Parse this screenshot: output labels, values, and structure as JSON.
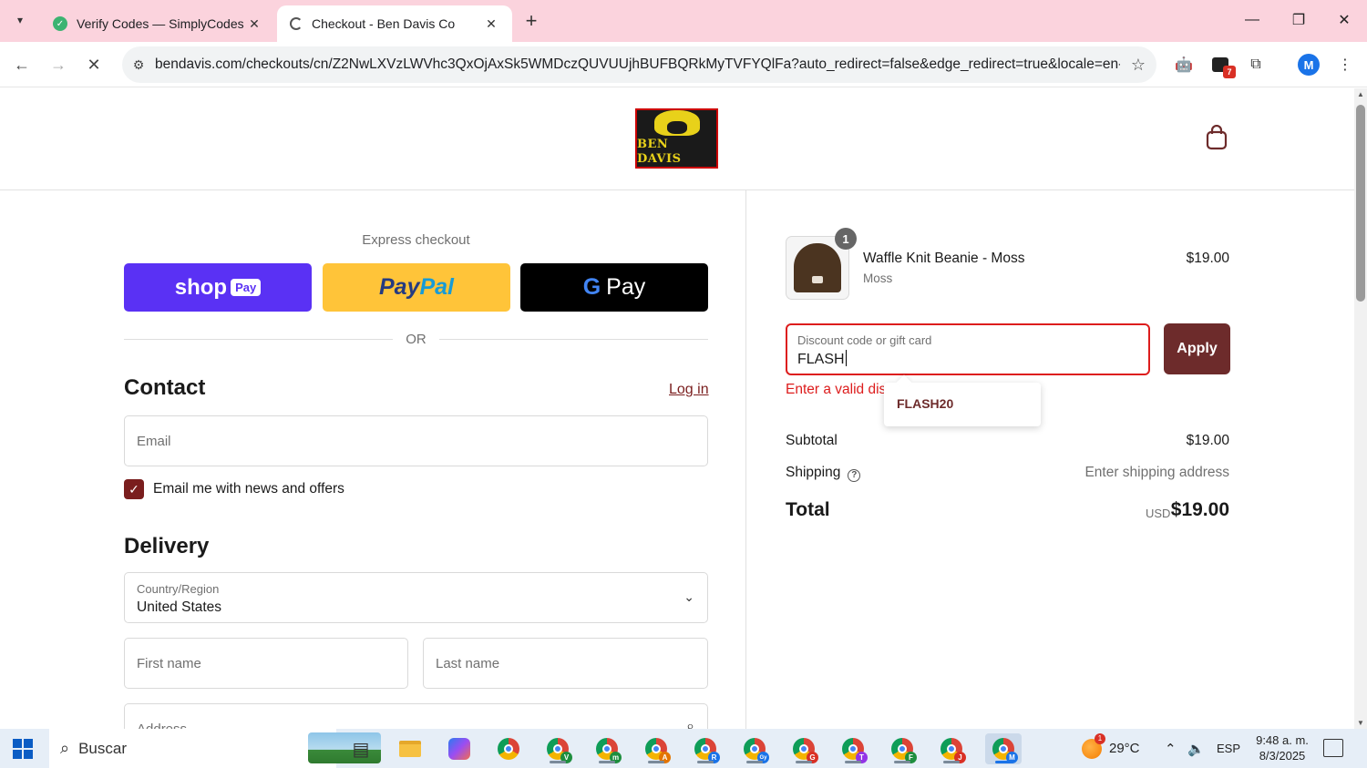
{
  "browser": {
    "tabs": [
      {
        "title": "Verify Codes — SimplyCodes",
        "favicon": "simplycodes-icon",
        "active": false
      },
      {
        "title": "Checkout - Ben Davis Co",
        "favicon": "loading-icon",
        "active": true
      }
    ],
    "url": "bendavis.com/checkouts/cn/Z2NwLXVzLWVhc3QxOjAxSk5WMDczQUVUUjhBUFBQRkMyTVFYQlFa?auto_redirect=false&edge_redirect=true&locale=en-...",
    "extension_badge": "7",
    "profile_initial": "M"
  },
  "header": {
    "logo_text": "BEN DAVIS"
  },
  "express": {
    "label": "Express checkout",
    "shop_text": "shop",
    "shop_chip": "Pay",
    "paypal_a": "Pay",
    "paypal_b": "Pal",
    "gpay_g": "G",
    "gpay_text": "Pay",
    "or": "OR"
  },
  "contact": {
    "heading": "Contact",
    "login": "Log in",
    "email_placeholder": "Email",
    "newsletter_label": "Email me with news and offers",
    "newsletter_checked": true
  },
  "delivery": {
    "heading": "Delivery",
    "country_label": "Country/Region",
    "country_value": "United States",
    "first_name": "First name",
    "last_name": "Last name",
    "address": "Address"
  },
  "summary": {
    "item": {
      "name": "Waffle Knit Beanie - Moss",
      "variant": "Moss",
      "price": "$19.00",
      "qty": "1"
    },
    "discount_label": "Discount code or gift card",
    "discount_value": "FLASH",
    "apply": "Apply",
    "error": "Enter a valid disc",
    "suggestion": "FLASH20",
    "subtotal_label": "Subtotal",
    "subtotal_value": "$19.00",
    "shipping_label": "Shipping",
    "shipping_value": "Enter shipping address",
    "total_label": "Total",
    "total_currency": "USD",
    "total_value": "$19.00"
  },
  "taskbar": {
    "search": "Buscar",
    "app_letters": [
      "V",
      "m",
      "A",
      "R",
      "Gy",
      "G",
      "T",
      "F",
      "J",
      "M"
    ],
    "weather": "29°C",
    "weather_badge": "1",
    "lang": "ESP",
    "time": "9:48 a. m.",
    "date": "8/3/2025"
  },
  "colors": {
    "accent": "#6d2b2b",
    "error": "#dd1d1d",
    "tabbar": "#fbd3dd"
  }
}
